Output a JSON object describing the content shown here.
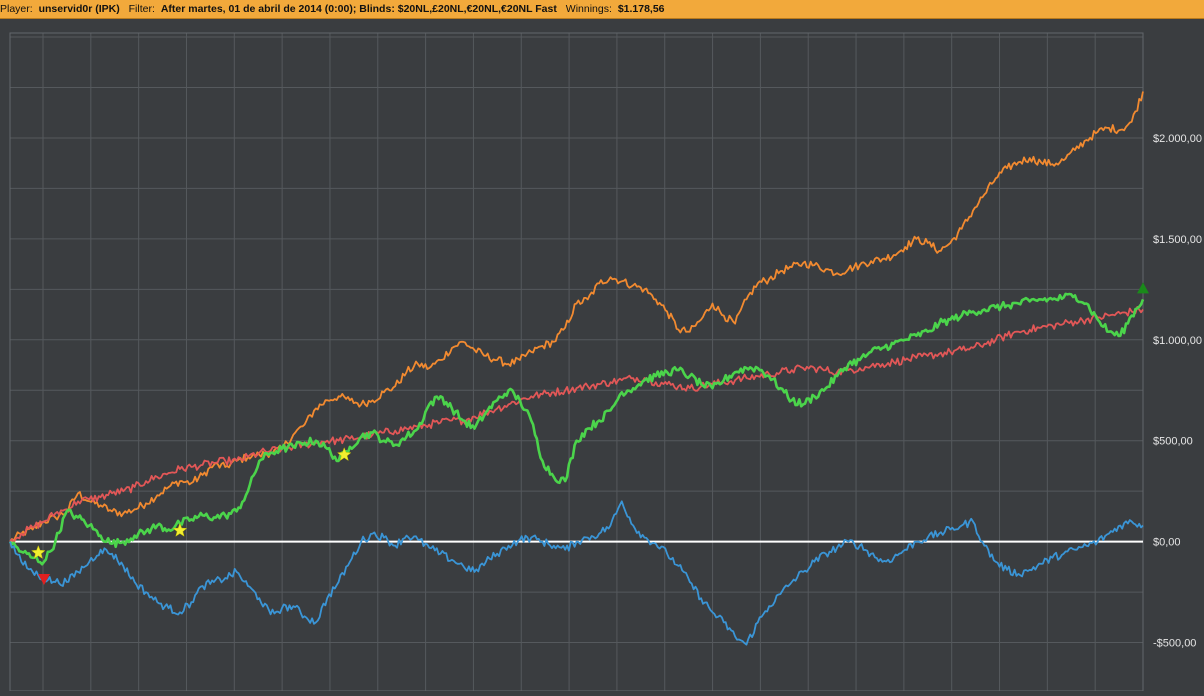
{
  "header": {
    "player_label": "Player:",
    "player_value": "unservid0r (IPK)",
    "filter_label": "Filter:",
    "filter_value": "After martes, 01 de abril de 2014 (0:00); Blinds: $20NL,£20NL,€20NL,€20NL Fast",
    "winnings_label": "Winnings:",
    "winnings_value": "$1.178,56"
  },
  "colors": {
    "background": "#3a3d40",
    "grid": "#55595d",
    "zero_line": "#ffffff",
    "header": "#f2a93b"
  },
  "chart_data": {
    "type": "line",
    "title": "",
    "xlabel": "",
    "ylabel": "",
    "ylim": [
      -740,
      2520
    ],
    "yticks": [
      -500,
      0,
      500,
      1000,
      1500,
      2000
    ],
    "ytick_labels": [
      "-$500,00",
      "$0,00",
      "$500,00",
      "$1.000,00",
      "$1.500,00",
      "$2.000,00"
    ],
    "grid": true,
    "zero_line": true,
    "x": [
      0,
      1,
      2,
      3,
      4,
      5,
      6,
      7,
      8,
      9,
      10,
      11,
      12,
      13,
      14,
      15,
      16,
      17,
      18,
      19,
      20,
      21,
      22,
      23,
      24,
      25,
      26,
      27,
      28,
      29,
      30,
      31,
      32,
      33,
      34,
      35,
      36,
      37,
      38,
      39,
      40,
      41,
      42,
      43,
      44,
      45,
      46,
      47,
      48,
      49,
      50,
      51,
      52,
      53,
      54,
      55,
      56,
      57,
      58,
      59,
      60,
      61,
      62,
      63,
      64,
      65,
      66,
      67,
      68,
      69,
      70,
      71,
      72,
      73,
      74,
      75,
      76,
      77,
      78,
      79,
      80,
      81,
      82,
      83,
      84,
      85,
      86,
      87,
      88,
      89,
      90,
      91,
      92,
      93,
      94,
      95,
      96,
      97,
      98,
      99,
      100
    ],
    "series": [
      {
        "color": "#f28a30",
        "values": [
          0,
          40,
          60,
          100,
          120,
          150,
          240,
          200,
          180,
          150,
          140,
          160,
          190,
          230,
          270,
          300,
          290,
          330,
          380,
          370,
          400,
          420,
          430,
          440,
          460,
          530,
          580,
          660,
          700,
          720,
          700,
          680,
          700,
          740,
          770,
          840,
          880,
          860,
          900,
          960,
          990,
          950,
          920,
          900,
          880,
          900,
          940,
          970,
          990,
          1060,
          1180,
          1200,
          1280,
          1310,
          1290,
          1270,
          1250,
          1200,
          1140,
          1050,
          1040,
          1100,
          1180,
          1120,
          1080,
          1200,
          1280,
          1300,
          1340,
          1360,
          1380,
          1370,
          1350,
          1330,
          1350,
          1370,
          1390,
          1400,
          1420,
          1460,
          1500,
          1480,
          1440,
          1480,
          1550,
          1640,
          1720,
          1800,
          1850,
          1880,
          1900,
          1880,
          1870,
          1890,
          1940,
          1990,
          2030,
          2050,
          2040,
          2080,
          2230
        ]
      },
      {
        "color": "#e25757",
        "values": [
          0,
          40,
          70,
          100,
          140,
          160,
          200,
          210,
          220,
          240,
          250,
          270,
          300,
          320,
          340,
          360,
          370,
          380,
          390,
          400,
          400,
          420,
          440,
          450,
          460,
          470,
          480,
          490,
          500,
          500,
          510,
          520,
          530,
          540,
          550,
          560,
          570,
          580,
          590,
          600,
          600,
          620,
          640,
          660,
          680,
          700,
          720,
          730,
          740,
          750,
          760,
          770,
          780,
          790,
          800,
          810,
          810,
          790,
          780,
          770,
          760,
          770,
          780,
          790,
          800,
          810,
          820,
          830,
          840,
          850,
          860,
          860,
          850,
          840,
          850,
          860,
          870,
          880,
          890,
          900,
          910,
          920,
          930,
          940,
          950,
          960,
          980,
          1000,
          1020,
          1040,
          1050,
          1060,
          1070,
          1080,
          1090,
          1100,
          1110,
          1120,
          1130,
          1140,
          1150
        ]
      },
      {
        "color": "#4bd44b",
        "values": [
          0,
          -50,
          -80,
          -100,
          0,
          150,
          120,
          80,
          30,
          -10,
          0,
          30,
          50,
          80,
          60,
          90,
          110,
          130,
          120,
          130,
          150,
          250,
          400,
          440,
          460,
          470,
          490,
          500,
          460,
          400,
          470,
          520,
          540,
          500,
          480,
          520,
          560,
          680,
          720,
          660,
          600,
          560,
          640,
          700,
          750,
          700,
          600,
          400,
          320,
          300,
          500,
          560,
          600,
          650,
          740,
          760,
          800,
          820,
          840,
          850,
          820,
          780,
          760,
          800,
          840,
          860,
          860,
          820,
          760,
          700,
          680,
          720,
          760,
          820,
          880,
          900,
          940,
          960,
          980,
          1000,
          1020,
          1040,
          1080,
          1100,
          1120,
          1140,
          1150,
          1160,
          1170,
          1180,
          1190,
          1200,
          1200,
          1210,
          1220,
          1180,
          1100,
          1040,
          1020,
          1120,
          1200
        ]
      },
      {
        "color": "#3a95d6",
        "values": [
          0,
          -100,
          -150,
          -180,
          -200,
          -200,
          -150,
          -100,
          -40,
          -60,
          -120,
          -200,
          -250,
          -300,
          -330,
          -350,
          -300,
          -220,
          -200,
          -180,
          -150,
          -220,
          -280,
          -360,
          -330,
          -320,
          -370,
          -400,
          -280,
          -200,
          -100,
          0,
          40,
          20,
          -20,
          30,
          10,
          -30,
          -60,
          -90,
          -120,
          -150,
          -100,
          -60,
          -20,
          10,
          20,
          0,
          -20,
          -40,
          0,
          20,
          40,
          80,
          200,
          80,
          20,
          -10,
          -60,
          -120,
          -200,
          -280,
          -350,
          -400,
          -470,
          -510,
          -400,
          -320,
          -260,
          -200,
          -150,
          -100,
          -60,
          -30,
          0,
          -20,
          -60,
          -100,
          -80,
          -40,
          0,
          20,
          40,
          60,
          80,
          100,
          -20,
          -100,
          -140,
          -160,
          -140,
          -110,
          -80,
          -60,
          -40,
          -20,
          0,
          40,
          80,
          100,
          80
        ]
      }
    ],
    "markers": [
      {
        "shape": "star",
        "color": "#f2ee30",
        "x": 2.5,
        "y": -55
      },
      {
        "shape": "star",
        "color": "#f2ee30",
        "x": 15,
        "y": 55
      },
      {
        "shape": "star",
        "color": "#f2ee30",
        "x": 29.5,
        "y": 430
      },
      {
        "shape": "triangle-down",
        "color": "#e02020",
        "x": 3,
        "y": -185
      },
      {
        "shape": "triangle-up",
        "color": "#1a8a1a",
        "x": 100,
        "y": 1255
      }
    ]
  }
}
